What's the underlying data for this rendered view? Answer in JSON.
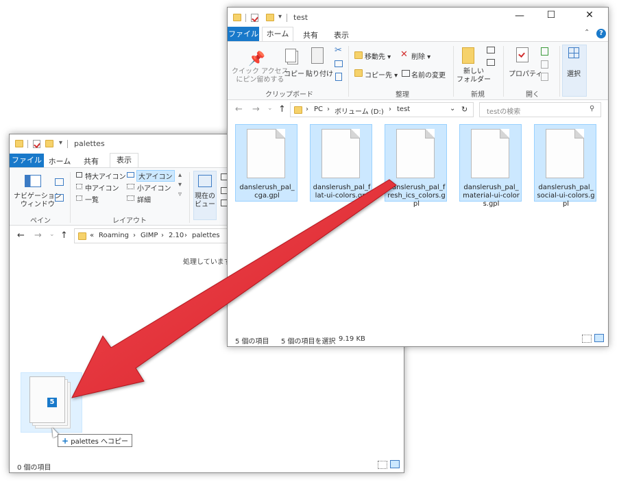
{
  "back_window": {
    "title": "palettes",
    "tabs": {
      "file": "ファイル",
      "home": "ホーム",
      "share": "共有",
      "view": "表示"
    },
    "ribbon": {
      "nav_pane": "ナビゲーション\nウィンドウ",
      "group_pane": "ペイン",
      "layout_items": [
        "特大アイコン",
        "大アイコン",
        "中アイコン",
        "小アイコン",
        "一覧",
        "詳細"
      ],
      "group_layout": "レイアウト",
      "current_view": "現在の\nビュー"
    },
    "address": {
      "prefix": "«",
      "crumbs": [
        "Roaming",
        "GIMP",
        "2.10",
        "palettes"
      ]
    },
    "processing_text": "処理しています...",
    "status": "0 個の項目"
  },
  "front_window": {
    "title": "test",
    "tabs": {
      "file": "ファイル",
      "home": "ホーム",
      "share": "共有",
      "view": "表示"
    },
    "ribbon": {
      "quick_access": "クイック アクセス\nにピン留めする",
      "copy": "コピー",
      "paste": "貼り付け",
      "group_clipboard": "クリップボード",
      "move_to": "移動先",
      "copy_to": "コピー先",
      "delete": "削除",
      "rename": "名前の変更",
      "group_organize": "整理",
      "new_folder": "新しい\nフォルダー",
      "group_new": "新規",
      "properties": "プロパティ",
      "group_open": "開く",
      "select": "選択"
    },
    "address": {
      "crumbs": [
        "PC",
        "ボリューム (D:)",
        "test"
      ]
    },
    "search_placeholder": "testの検索",
    "files": [
      "danslerush_pal_cga.gpl",
      "danslerush_pal_flat-ui-colors.gpl",
      "danslerush_pal_fresh_ics_colors.gpl",
      "danslerush_pal_material-ui-colors.gpl",
      "danslerush_pal_social-ui-colors.gpl"
    ],
    "status": {
      "count": "5 個の項目",
      "selected": "5 個の項目を選択",
      "size": "9.19 KB"
    }
  },
  "drag": {
    "badge": "5",
    "tooltip_plus": "+",
    "tooltip": "palettes へコピー"
  },
  "colors": {
    "file_tab": "#1979ca",
    "selection": "#cce8ff",
    "selection_border": "#99d1ff",
    "arrow": "#e0262d"
  },
  "icons": [
    "folder-icon",
    "checkmark-icon",
    "pin-icon",
    "copy-icon",
    "paste-icon",
    "cut-icon",
    "move-icon",
    "delete-icon",
    "rename-icon",
    "new-folder-icon",
    "properties-icon",
    "select-icon",
    "refresh-icon",
    "search-icon",
    "help-icon",
    "chevron-up-icon",
    "arrow-left-icon",
    "arrow-right-icon",
    "arrow-up-icon",
    "document-icon",
    "cursor-icon",
    "big-red-arrow"
  ]
}
